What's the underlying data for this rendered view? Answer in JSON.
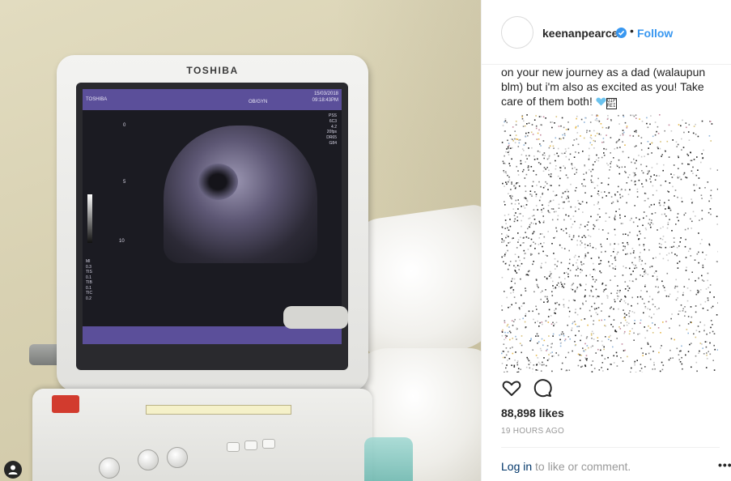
{
  "post": {
    "monitor_brand": "TOSHIBA",
    "screen": {
      "tag": "TOSHIBA",
      "date_line1": "15/03/2018",
      "date_line2": "09:18:43PM",
      "mode": "OB/GYN",
      "params": "PSS\n6C3\n4.2\n20fps\nDR65\nG84",
      "scale_0": "0",
      "scale_5": "5",
      "scale_10": "10",
      "mi_block": "MI\n0.3\nTIS\n0.1\nTIB\n0.1\nTIC\n0.2"
    }
  },
  "sidebar": {
    "username": "keenanpearce",
    "verified_icon": "verified-badge-icon",
    "separator": "•",
    "follow_label": "Follow",
    "caption_text": "on your new journey as a dad (walaupun blm) but i'm also as excited as you! Take care of them both! ",
    "emoji_box_text": "QIP\nREI",
    "likes": "88,898 likes",
    "time": "19 HOURS AGO",
    "login_link": "Log in",
    "login_rest": " to like or comment.",
    "more_label": "•••"
  },
  "colors": {
    "accent": "#3897f0",
    "link_dark": "#003569",
    "muted": "#999999",
    "text": "#262626"
  }
}
